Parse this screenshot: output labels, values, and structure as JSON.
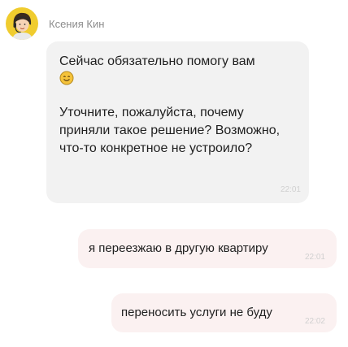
{
  "sender": {
    "name": "Ксения Кин",
    "avatar_bg": "#f0cc2e"
  },
  "messages": [
    {
      "direction": "incoming",
      "paragraph1": "Сейчас обязательно помогу вам",
      "emoji": "smiling-face-icon",
      "paragraph2": "Уточните, пожалуйста, почему приняли такое решение? Возможно, что-то конкретное не устроило?",
      "time": "22:01"
    },
    {
      "direction": "outgoing",
      "text": "я переезжаю в другую квартиру",
      "time": "22:01"
    },
    {
      "direction": "outgoing",
      "text": "переносить услуги не буду",
      "time": "22:02"
    }
  ],
  "colors": {
    "incoming_bubble": "#f2f2f2",
    "outgoing_bubble": "#fbf1f1",
    "timestamp": "#d0d0d0",
    "sender_name": "#8c8c8c"
  }
}
